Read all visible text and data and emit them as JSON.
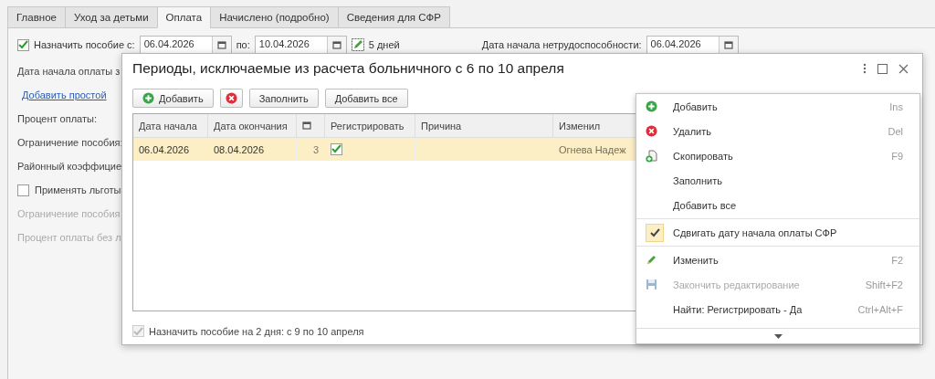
{
  "tabs": [
    {
      "label": "Главное",
      "selected": false
    },
    {
      "label": "Уход за детьми",
      "selected": false
    },
    {
      "label": "Оплата",
      "selected": true
    },
    {
      "label": "Начислено (подробно)",
      "selected": false
    },
    {
      "label": "Сведения для СФР",
      "selected": false
    }
  ],
  "benefit_period": {
    "checked": true,
    "label": "Назначить пособие с:",
    "from": "06.04.2026",
    "to_label": "по:",
    "to": "10.04.2026",
    "days": "5 дней",
    "incapacity_label": "Дата начала нетрудоспособности:",
    "incapacity_date": "06.04.2026"
  },
  "form_fields": [
    {
      "kind": "label",
      "text": "Дата начала оплаты з",
      "disabled": false
    },
    {
      "kind": "link",
      "text": "Добавить простой",
      "disabled": false
    },
    {
      "kind": "label",
      "text": "Процент оплаты:",
      "disabled": false
    },
    {
      "kind": "label",
      "text": "Ограничение пособия:",
      "disabled": false
    },
    {
      "kind": "label",
      "text": "Районный коэффицие",
      "disabled": false
    },
    {
      "kind": "checkbox",
      "text": "Применять льготы",
      "checked": false,
      "disabled": false
    },
    {
      "kind": "label",
      "text": "Ограничение пособия",
      "disabled": true
    },
    {
      "kind": "label",
      "text": "Процент оплаты без л",
      "disabled": true
    }
  ],
  "dialog": {
    "title": "Периоды, исключаемые из расчета больничного с 6 по 10 апреля",
    "toolbar": [
      {
        "kind": "add",
        "label": "Добавить"
      },
      {
        "kind": "delete"
      },
      {
        "kind": "text",
        "label": "Заполнить"
      },
      {
        "kind": "text",
        "label": "Добавить все"
      }
    ],
    "table": {
      "columns": [
        "Дата начала",
        "Дата окончания",
        "",
        "Регистрировать",
        "Причина",
        "Изменил"
      ],
      "rows": [
        {
          "selected": true,
          "start": "06.04.2026",
          "end": "08.04.2026",
          "days": "3",
          "register": true,
          "reason": "",
          "changed_by": "Огнева Надеж"
        }
      ]
    },
    "footer": {
      "checked": true,
      "disabled": true,
      "label": "Назначить пособие на 2 дня: с 9 по 10 апреля"
    }
  },
  "context_menu": {
    "items": [
      {
        "kind": "command",
        "label": "Добавить",
        "shortcut": "Ins",
        "disabled": false
      },
      {
        "kind": "command",
        "label": "Удалить",
        "shortcut": "Del",
        "disabled": false
      },
      {
        "kind": "command",
        "label": "Скопировать",
        "shortcut": "F9",
        "disabled": false
      },
      {
        "kind": "command",
        "label": "Заполнить",
        "disabled": false
      },
      {
        "kind": "command",
        "label": "Добавить все",
        "disabled": false
      },
      {
        "kind": "separator"
      },
      {
        "kind": "toggle",
        "label": "Сдвигать дату начала оплаты СФР",
        "checked": true
      },
      {
        "kind": "separator"
      },
      {
        "kind": "command",
        "label": "Изменить",
        "shortcut": "F2",
        "disabled": false
      },
      {
        "kind": "command",
        "label": "Закончить редактирование",
        "shortcut": "Shift+F2",
        "disabled": true
      },
      {
        "kind": "command",
        "label": "Найти: Регистрировать - Да",
        "shortcut": "Ctrl+Alt+F",
        "disabled": false
      }
    ]
  }
}
